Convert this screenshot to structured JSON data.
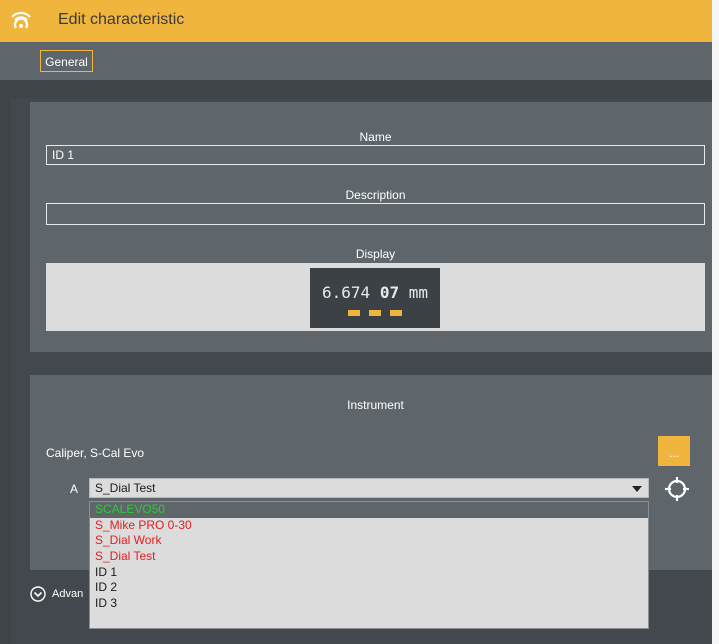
{
  "window": {
    "title": "Edit characteristic"
  },
  "tabs": [
    {
      "label": "General"
    }
  ],
  "name": {
    "label": "Name",
    "value": "ID 1"
  },
  "description": {
    "label": "Description",
    "value": ""
  },
  "display": {
    "label": "Display",
    "reading_main": "6.674 ",
    "reading_bold": "07",
    "unit": " mm"
  },
  "instrument": {
    "label": "Instrument",
    "name": "Caliper, S-Cal Evo",
    "more_button": "...",
    "channel": "A",
    "selected": "S_Dial Test",
    "options": [
      {
        "label": "SCALEVO50",
        "color": "#2ecc2e"
      },
      {
        "label": "S_Mike PRO 0-30",
        "color": "#e02020"
      },
      {
        "label": "S_Dial Work",
        "color": "#e02020"
      },
      {
        "label": "S_Dial Test",
        "color": "#e02020"
      },
      {
        "label": "ID 1",
        "color": "#1a1a1a"
      },
      {
        "label": "ID 2",
        "color": "#1a1a1a"
      },
      {
        "label": "ID 3",
        "color": "#1a1a1a"
      }
    ]
  },
  "advanced": {
    "label": "Advan"
  },
  "colors": {
    "accent": "#f0b53c",
    "panel": "#5e666b",
    "background": "#42484d"
  }
}
